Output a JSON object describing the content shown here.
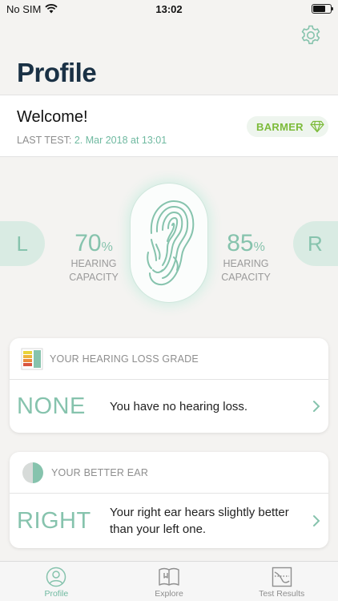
{
  "status_bar": {
    "carrier": "No SIM",
    "time": "13:02"
  },
  "header": {
    "title": "Profile"
  },
  "welcome": {
    "greeting": "Welcome!",
    "last_test_label": "LAST TEST:",
    "last_test_date": "2. Mar 2018 at 13:01",
    "brand": "BARMER"
  },
  "hearing": {
    "left_tab": "L",
    "right_tab": "R",
    "left": {
      "value": "70",
      "unit": "%",
      "label_line1": "HEARING",
      "label_line2": "CAPACITY"
    },
    "right": {
      "value": "85",
      "unit": "%",
      "label_line1": "HEARING",
      "label_line2": "CAPACITY"
    }
  },
  "loss_grade": {
    "header": "YOUR HEARING LOSS GRADE",
    "value": "NONE",
    "description": "You have no hearing loss."
  },
  "better_ear": {
    "header": "YOUR BETTER EAR",
    "value": "RIGHT",
    "description": "Your right ear hears slightly better than your left one."
  },
  "tabs": [
    {
      "label": "Profile",
      "icon": "person-icon",
      "active": true
    },
    {
      "label": "Explore",
      "icon": "book-icon",
      "active": false
    },
    {
      "label": "Test Results",
      "icon": "chart-icon",
      "active": false
    }
  ],
  "colors": {
    "accent": "#86c3ad",
    "accent_text": "#6fb9a0",
    "title": "#1a3145",
    "brand": "#7cbb3a"
  }
}
